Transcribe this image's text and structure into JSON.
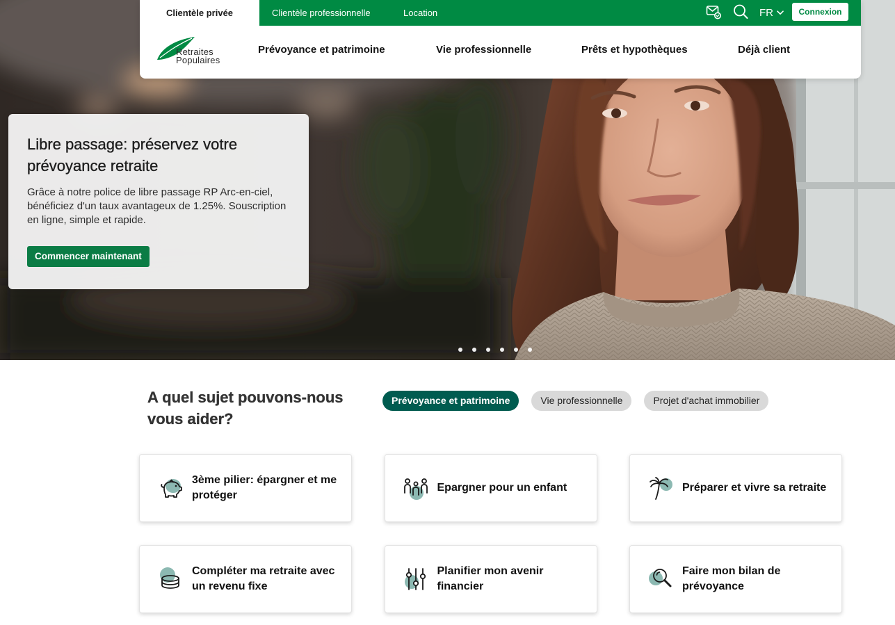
{
  "header": {
    "top_tabs": [
      {
        "label": "Clientèle privée",
        "active": true
      },
      {
        "label": "Clientèle professionnelle",
        "active": false
      },
      {
        "label": "Location",
        "active": false
      }
    ],
    "utility_icons": [
      "contact-icon",
      "search-icon"
    ],
    "language": "FR",
    "language_icon": "chevron-down-icon",
    "login_label": "Connexion",
    "logo": {
      "line1": "Retraites",
      "line2": "Populaires",
      "icon": "leaf-logo-icon"
    },
    "nav": [
      {
        "label": "Prévoyance et patrimoine"
      },
      {
        "label": "Vie professionnelle"
      },
      {
        "label": "Prêts et hypothèques"
      },
      {
        "label": "Déjà client"
      }
    ]
  },
  "hero": {
    "title": "Libre passage: préservez votre prévoyance retraite",
    "text": "Grâce à notre police de libre passage RP Arc-en-ciel, bénéficiez d'un taux avantageux de 1.25%. Souscription en ligne, simple et rapide.",
    "cta_label": "Commencer maintenant",
    "slide_count": 6
  },
  "topics": {
    "heading": "A quel sujet pouvons-nous vous aider?",
    "filters": [
      {
        "label": "Prévoyance et patrimoine",
        "active": true
      },
      {
        "label": "Vie professionnelle",
        "active": false
      },
      {
        "label": "Projet d'achat immobilier",
        "active": false
      }
    ],
    "cards": [
      {
        "label": "3ème pilier: épargner et me protéger",
        "icon": "piggy-bank-icon"
      },
      {
        "label": "Epargner pour un enfant",
        "icon": "family-icon"
      },
      {
        "label": "Préparer et vivre sa retraite",
        "icon": "palm-tree-icon"
      },
      {
        "label": "Compléter ma retraite avec un revenu fixe",
        "icon": "coins-icon"
      },
      {
        "label": "Planifier mon avenir financier",
        "icon": "sliders-icon"
      },
      {
        "label": "Faire mon bilan de prévoyance",
        "icon": "magnifier-icon"
      }
    ]
  },
  "colors": {
    "brand_green": "#008a43",
    "cta_green": "#0b7c45",
    "filter_active": "#005c50",
    "filter_inactive": "#d9d9d9",
    "icon_accent": "#8cb9b2"
  }
}
